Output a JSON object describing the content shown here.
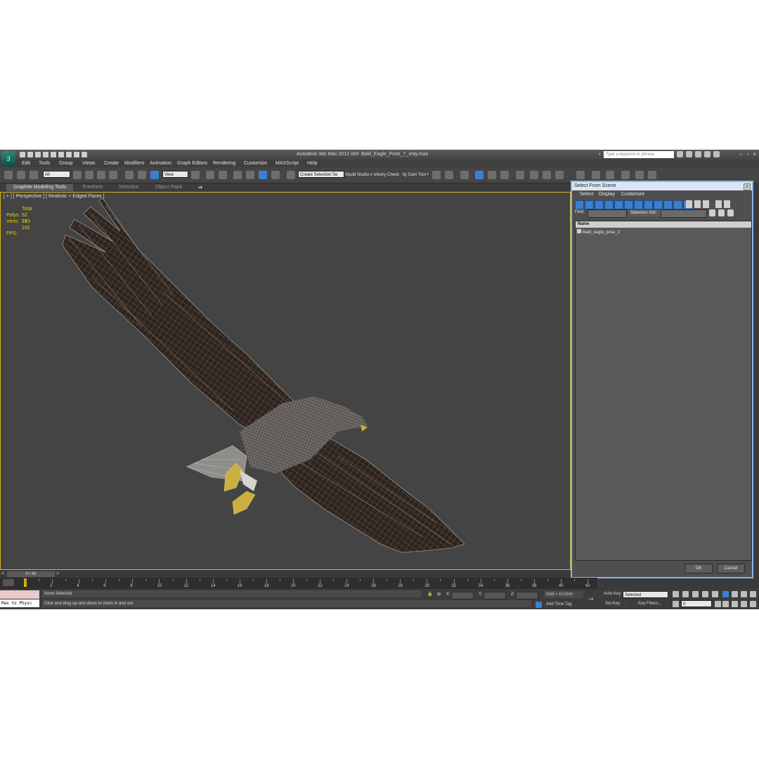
{
  "window": {
    "app_title": "Autodesk 3ds Max  2012 x64",
    "file_name": "Bald_Eagle_Pose_7_vray.max",
    "search_placeholder": "Type a keyword or phrase"
  },
  "menu": [
    "Edit",
    "Tools",
    "Group",
    "Views",
    "Create",
    "Modifiers",
    "Animation",
    "Graph Editors",
    "Rendering",
    "Customize",
    "MAXScript",
    "Help"
  ],
  "toolbar": {
    "selection_filter": "All",
    "ref_coord": "View",
    "named_selection_set": "Create Selection Se",
    "plugin_text_1": "Squid Studio v",
    "plugin_text_2": "elivery Check",
    "plugin_text_3": "ity Cam Tool •"
  },
  "ribbon": {
    "tabs": [
      "Graphite Modeling Tools",
      "Freeform",
      "Selection",
      "Object Paint"
    ],
    "active_tab": "Graphite Modeling Tools"
  },
  "viewport": {
    "label": "[ + ] [ Perspective ] [ Realistic + Edged Faces ]",
    "stats": {
      "header": "Total",
      "polys_label": "Polys:",
      "polys_value": "52 273",
      "verts_label": "Verts:",
      "verts_value": "74 192",
      "fps_label": "FPS:"
    }
  },
  "dialog": {
    "title": "Select From Scene",
    "close": "x",
    "menu": [
      "Select",
      "Display",
      "Customize"
    ],
    "find_label": "Find:",
    "selection_set_label": "Selection Set:",
    "column_header": "Name",
    "items": [
      "Bald_eagle_pose_2"
    ],
    "ok": "OK",
    "cancel": "Cancel"
  },
  "timeline": {
    "frame_display": "0 / 42",
    "ticks": [
      "2",
      "4",
      "6",
      "8",
      "10",
      "12",
      "14",
      "16",
      "18",
      "20",
      "22",
      "24",
      "26",
      "28",
      "30",
      "32",
      "34",
      "36",
      "38",
      "40",
      "42"
    ]
  },
  "status": {
    "maxscript_text": "Max to Physc",
    "selection_status": "None Selected",
    "prompt": "Click and drag up-and-down to zoom in and out",
    "x_label": "X:",
    "y_label": "Y:",
    "z_label": "Z:",
    "grid": "Grid = 10,0cm",
    "add_time_tag": "Add Time Tag",
    "auto_key": "Auto Key",
    "auto_key_mode": "Selected",
    "set_key": "Set Key",
    "key_filters": "Key Filters...",
    "current_frame": "0"
  },
  "colors": {
    "viewport_bg": "#444444",
    "accent_blue": "#3a7fd4",
    "stats_yellow": "#e8d200",
    "active_border": "#d9b21b"
  }
}
